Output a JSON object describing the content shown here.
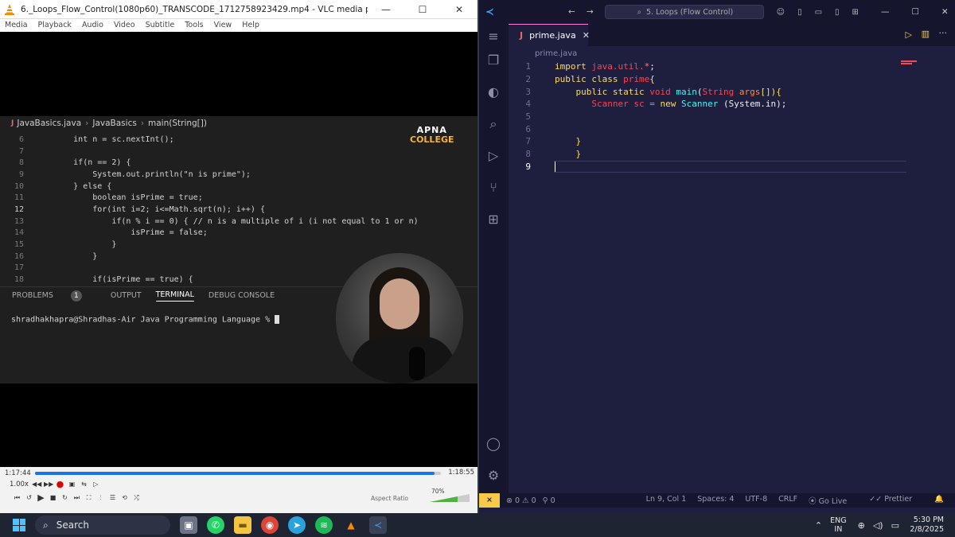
{
  "vlc": {
    "title": "6._Loops_Flow_Control(1080p60)_TRANSCODE_1712758923429.mp4 - VLC media player",
    "minimize": "—",
    "maximize": "☐",
    "close": "✕",
    "menu": [
      "Media",
      "Playback",
      "Audio",
      "Video",
      "Subtitle",
      "Tools",
      "View",
      "Help"
    ],
    "video": {
      "breadcrumb": [
        "JavaBasics.java",
        "JavaBasics",
        "main(String[])"
      ],
      "logo_top": "APNA",
      "logo_bottom": "COLLEGE",
      "code": [
        {
          "n": "6",
          "text": "        int n = sc.nextInt();"
        },
        {
          "n": "7",
          "text": ""
        },
        {
          "n": "8",
          "text": "        if(n == 2) {"
        },
        {
          "n": "9",
          "text": "            System.out.println(\"n is prime\");"
        },
        {
          "n": "10",
          "text": "        } else {"
        },
        {
          "n": "11",
          "text": "            boolean isPrime = true;"
        },
        {
          "n": "12",
          "text": "            for(int i=2; i<=Math.sqrt(n); i++) {"
        },
        {
          "n": "13",
          "text": "                if(n % i == 0) { // n is a multiple of i (i not equal to 1 or n)"
        },
        {
          "n": "14",
          "text": "                    isPrime = false;"
        },
        {
          "n": "15",
          "text": "                }"
        },
        {
          "n": "16",
          "text": "            }"
        },
        {
          "n": "17",
          "text": ""
        },
        {
          "n": "18",
          "text": "            if(isPrime == true) {"
        }
      ],
      "panel_tabs": [
        "PROBLEMS",
        "OUTPUT",
        "TERMINAL",
        "DEBUG CONSOLE"
      ],
      "problems_count": "1",
      "terminal_prompt": "shradhakhapra@Shradhas-Air Java Programming Language % "
    },
    "controls": {
      "elapsed": "1:17:44",
      "total": "1:18:55",
      "progress": 0.985,
      "rate": "1.00x",
      "aspect": "Aspect Ratio",
      "volume_label": "70%",
      "volume": 0.7
    }
  },
  "vscode": {
    "search": "5. Loops (Flow Control)",
    "tab": "prime.java",
    "breadcrumb": "prime.java",
    "current_line": "9",
    "lines": [
      {
        "n": "1",
        "tokens": [
          {
            "t": "import ",
            "c": "kw"
          },
          {
            "t": "java.util.",
            "c": "ty"
          },
          {
            "t": "*",
            "c": "br"
          },
          {
            "t": ";",
            "c": "pl"
          }
        ]
      },
      {
        "n": "2",
        "tokens": [
          {
            "t": "public ",
            "c": "kw"
          },
          {
            "t": "class ",
            "c": "kw"
          },
          {
            "t": "prime",
            "c": "ty"
          },
          {
            "t": "{",
            "c": "kw"
          }
        ]
      },
      {
        "n": "3",
        "tokens": [
          {
            "t": "    public ",
            "c": "kw"
          },
          {
            "t": "static ",
            "c": "kw"
          },
          {
            "t": "void ",
            "c": "ty"
          },
          {
            "t": "main",
            "c": "fn"
          },
          {
            "t": "(",
            "c": "pl"
          },
          {
            "t": "String ",
            "c": "ty"
          },
          {
            "t": "args",
            "c": "st"
          },
          {
            "t": "[]){",
            "c": "kw"
          }
        ]
      },
      {
        "n": "4",
        "tokens": [
          {
            "t": "       Scanner ",
            "c": "ty"
          },
          {
            "t": "sc ",
            "c": "ty"
          },
          {
            "t": "= ",
            "c": "br"
          },
          {
            "t": "new ",
            "c": "kw"
          },
          {
            "t": "Scanner ",
            "c": "fn"
          },
          {
            "t": "(System.in);",
            "c": "pl"
          }
        ]
      },
      {
        "n": "5",
        "tokens": []
      },
      {
        "n": "6",
        "tokens": []
      },
      {
        "n": "7",
        "tokens": [
          {
            "t": "    }",
            "c": "kw"
          }
        ]
      },
      {
        "n": "8",
        "tokens": [
          {
            "t": "    }",
            "c": "kw"
          }
        ]
      },
      {
        "n": "9",
        "tokens": []
      }
    ],
    "status": {
      "errors": "0",
      "warnings": "0",
      "ports": "0",
      "position": "Ln 9, Col 1",
      "spaces": "Spaces: 4",
      "encoding": "UTF-8",
      "eol": "CRLF",
      "golive": "Go Live",
      "prettier": "Prettier"
    }
  },
  "taskbar": {
    "search": "Search",
    "lang_top": "ENG",
    "lang_bottom": "IN",
    "time": "5:30 PM",
    "date": "2/8/2025"
  }
}
